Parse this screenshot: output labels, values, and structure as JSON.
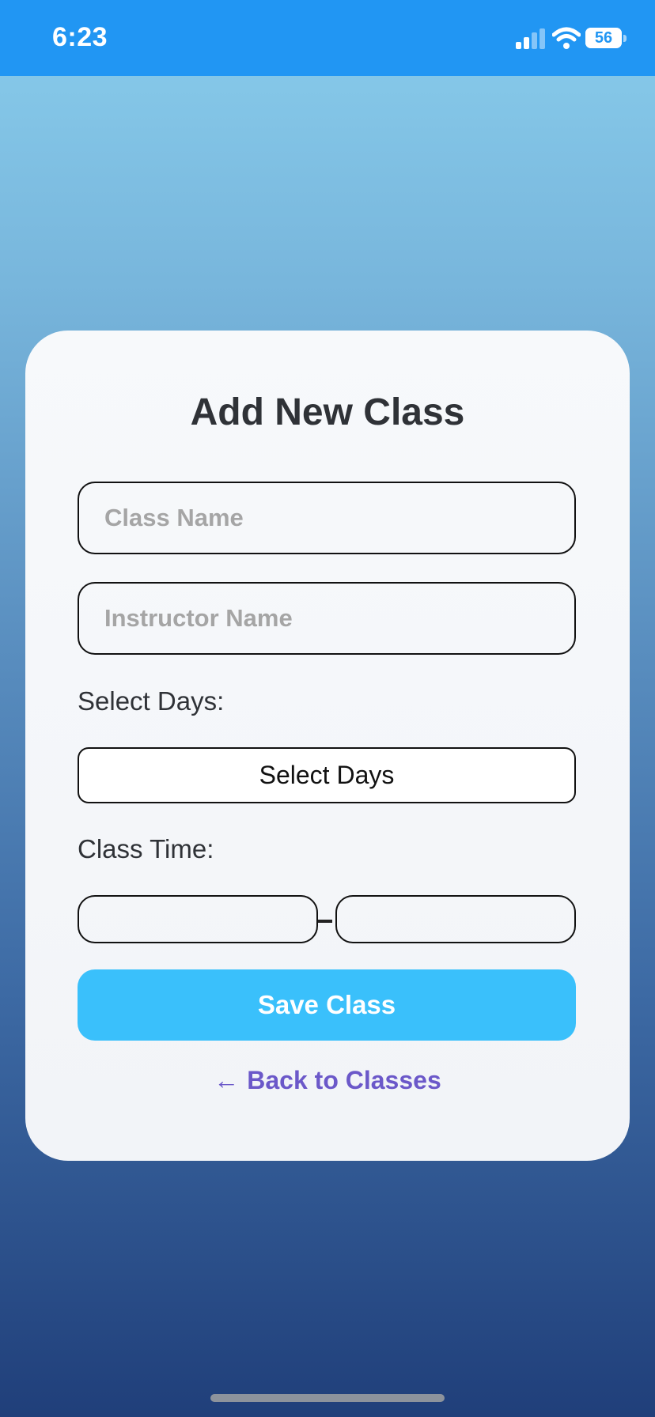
{
  "status_bar": {
    "time": "6:23",
    "battery_level": "56",
    "signal_icon": "cellular-signal-icon",
    "wifi_icon": "wifi-icon",
    "battery_icon": "battery-icon",
    "background_color": "#2196f3"
  },
  "form": {
    "title": "Add New Class",
    "class_name_placeholder": "Class Name",
    "instructor_name_placeholder": "Instructor Name",
    "select_days_label": "Select Days:",
    "select_days_button": "Select Days",
    "class_time_label": "Class Time:",
    "start_time_value": "",
    "end_time_value": "",
    "time_separator": "–",
    "save_button": "Save Class",
    "back_link": "Back to Classes",
    "back_icon": "arrow-left-icon",
    "accent_color": "#3ac0fb",
    "link_color": "#6b58c9"
  }
}
